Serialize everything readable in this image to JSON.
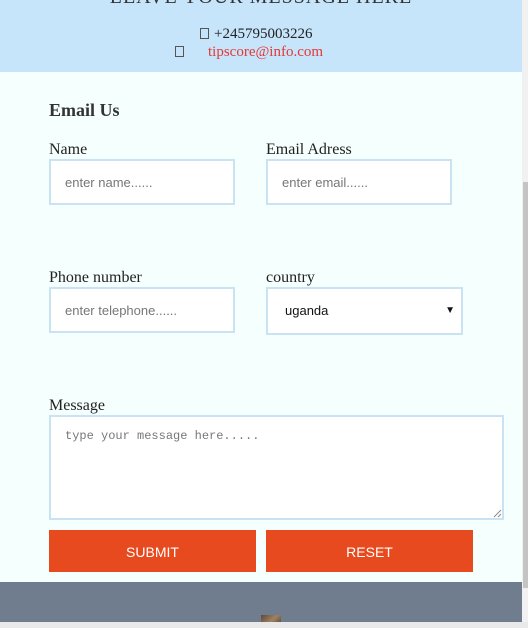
{
  "header": {
    "title_cut": "LEAVE YOUR MESSAGE HERE",
    "phone": "+245795003226",
    "email": "tipscore@info.com"
  },
  "form": {
    "section_title": "Email Us",
    "name": {
      "label": "Name",
      "placeholder": "enter name......"
    },
    "email": {
      "label": "Email Adress",
      "placeholder": "enter email......"
    },
    "phone": {
      "label": "Phone number",
      "placeholder": "enter telephone......"
    },
    "country": {
      "label": "country",
      "selected": "uganda"
    },
    "message": {
      "label": "Message",
      "placeholder": "type your message here....."
    },
    "submit_label": "SUBMIT",
    "reset_label": "RESET"
  },
  "colors": {
    "header_bg": "#c6e4fa",
    "form_bg": "#f5fffe",
    "button_bg": "#e84a1f",
    "footer_bg": "#6f7d8e",
    "link": "#e53935"
  }
}
